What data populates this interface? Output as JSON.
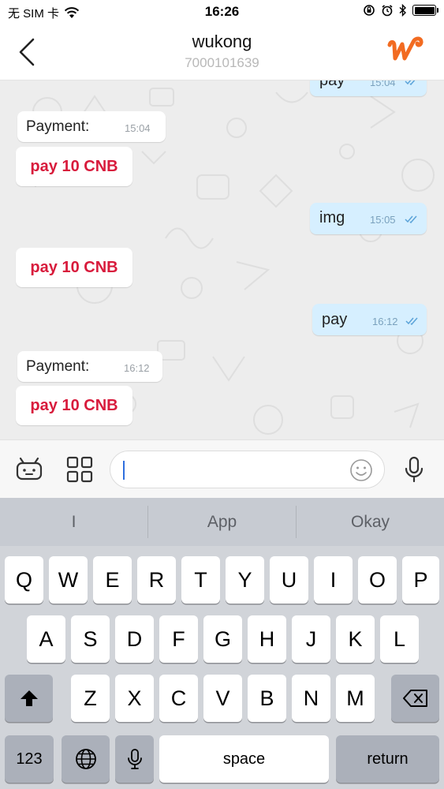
{
  "status_bar": {
    "carrier": "无 SIM 卡",
    "time": "16:26"
  },
  "header": {
    "title": "wukong",
    "subtitle": "7000101639"
  },
  "messages": [
    {
      "dir": "out",
      "type": "text",
      "text": "pay",
      "time": "15:04"
    },
    {
      "dir": "in",
      "type": "label",
      "text": "Payment:",
      "time": "15:04"
    },
    {
      "dir": "in",
      "type": "pay",
      "text": "pay 10 CNB"
    },
    {
      "dir": "out",
      "type": "text",
      "text": "img",
      "time": "15:05"
    },
    {
      "dir": "in",
      "type": "pay",
      "text": "pay 10 CNB"
    },
    {
      "dir": "out",
      "type": "text",
      "text": "pay",
      "time": "16:12"
    },
    {
      "dir": "in",
      "type": "label",
      "text": "Payment:",
      "time": "16:12"
    },
    {
      "dir": "in",
      "type": "pay",
      "text": "pay 10 CNB"
    }
  ],
  "input": {
    "value": ""
  },
  "keyboard": {
    "suggestions": [
      "I",
      "App",
      "Okay"
    ],
    "row1": [
      "Q",
      "W",
      "E",
      "R",
      "T",
      "Y",
      "U",
      "I",
      "O",
      "P"
    ],
    "row2": [
      "A",
      "S",
      "D",
      "F",
      "G",
      "H",
      "J",
      "K",
      "L"
    ],
    "row3": [
      "Z",
      "X",
      "C",
      "V",
      "B",
      "N",
      "M"
    ],
    "numbers_key": "123",
    "space_key": "space",
    "return_key": "return"
  },
  "colors": {
    "pay_text": "#d81b3c",
    "outgoing_bubble": "#d6efff",
    "incoming_bubble": "#ffffff",
    "logo": "#f26b21",
    "chat_background": "#ededed"
  }
}
